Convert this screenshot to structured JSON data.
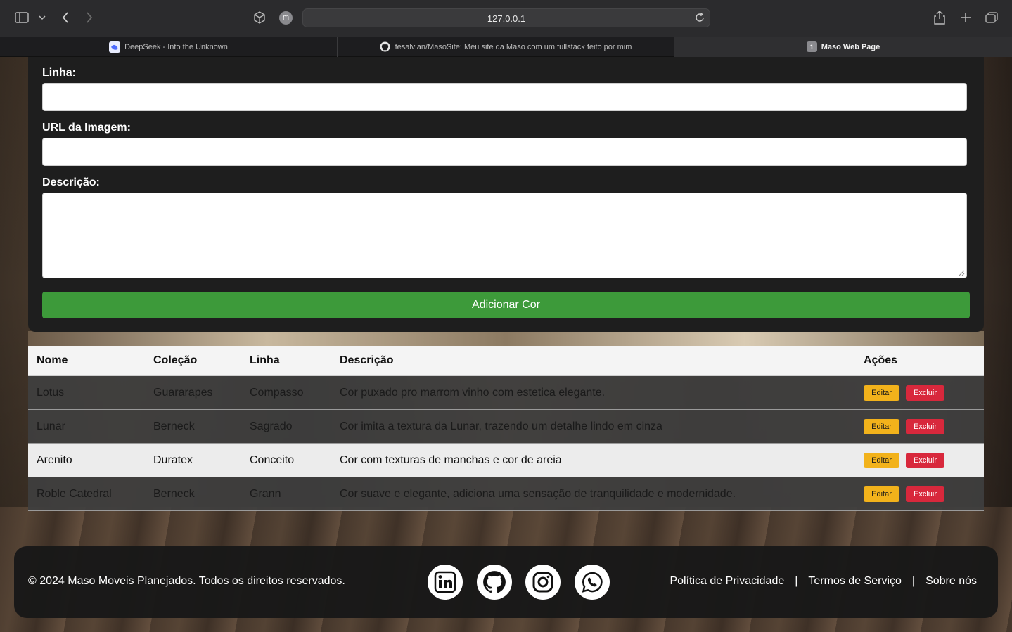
{
  "browser": {
    "url": "127.0.0.1",
    "profile_initial": "m",
    "tabs": [
      {
        "label": "DeepSeek - Into the Unknown"
      },
      {
        "label": "fesalvian/MasoSite: Meu site da Maso com um fullstack feito por mim"
      },
      {
        "label": "Maso Web Page",
        "badge": "1"
      }
    ]
  },
  "form": {
    "linha_label": "Linha:",
    "url_label": "URL da Imagem:",
    "descricao_label": "Descrição:",
    "submit_label": "Adicionar Cor"
  },
  "table": {
    "headers": [
      "Nome",
      "Coleção",
      "Linha",
      "Descrição",
      "Ações"
    ],
    "rows": [
      [
        "Lotus",
        "Guararapes",
        "Compasso",
        "Cor puxado pro marrom vinho com estetica elegante."
      ],
      [
        "Lunar",
        "Berneck",
        "Sagrado",
        "Cor imita a textura da Lunar, trazendo um detalhe lindo em cinza"
      ],
      [
        "Arenito",
        "Duratex",
        "Conceito",
        "Cor com texturas de manchas e cor de areia"
      ],
      [
        "Roble Catedral",
        "Berneck",
        "Grann",
        "Cor suave e elegante, adiciona uma sensação de tranquilidade e modernidade."
      ]
    ],
    "edit_label": "Editar",
    "delete_label": "Excluir"
  },
  "footer": {
    "copyright": "© 2024 Maso Moveis Planejados. Todos os direitos reservados.",
    "links": [
      "Política de Privacidade",
      "|",
      "Termos de Serviço",
      "|",
      "Sobre nós"
    ],
    "social_icons": [
      "linkedin-icon",
      "github-icon",
      "instagram-icon",
      "whatsapp-icon"
    ]
  },
  "colors": {
    "submit_green": "#3d9a3a",
    "edit_yellow": "#f2b21b",
    "delete_red": "#d8283c"
  }
}
